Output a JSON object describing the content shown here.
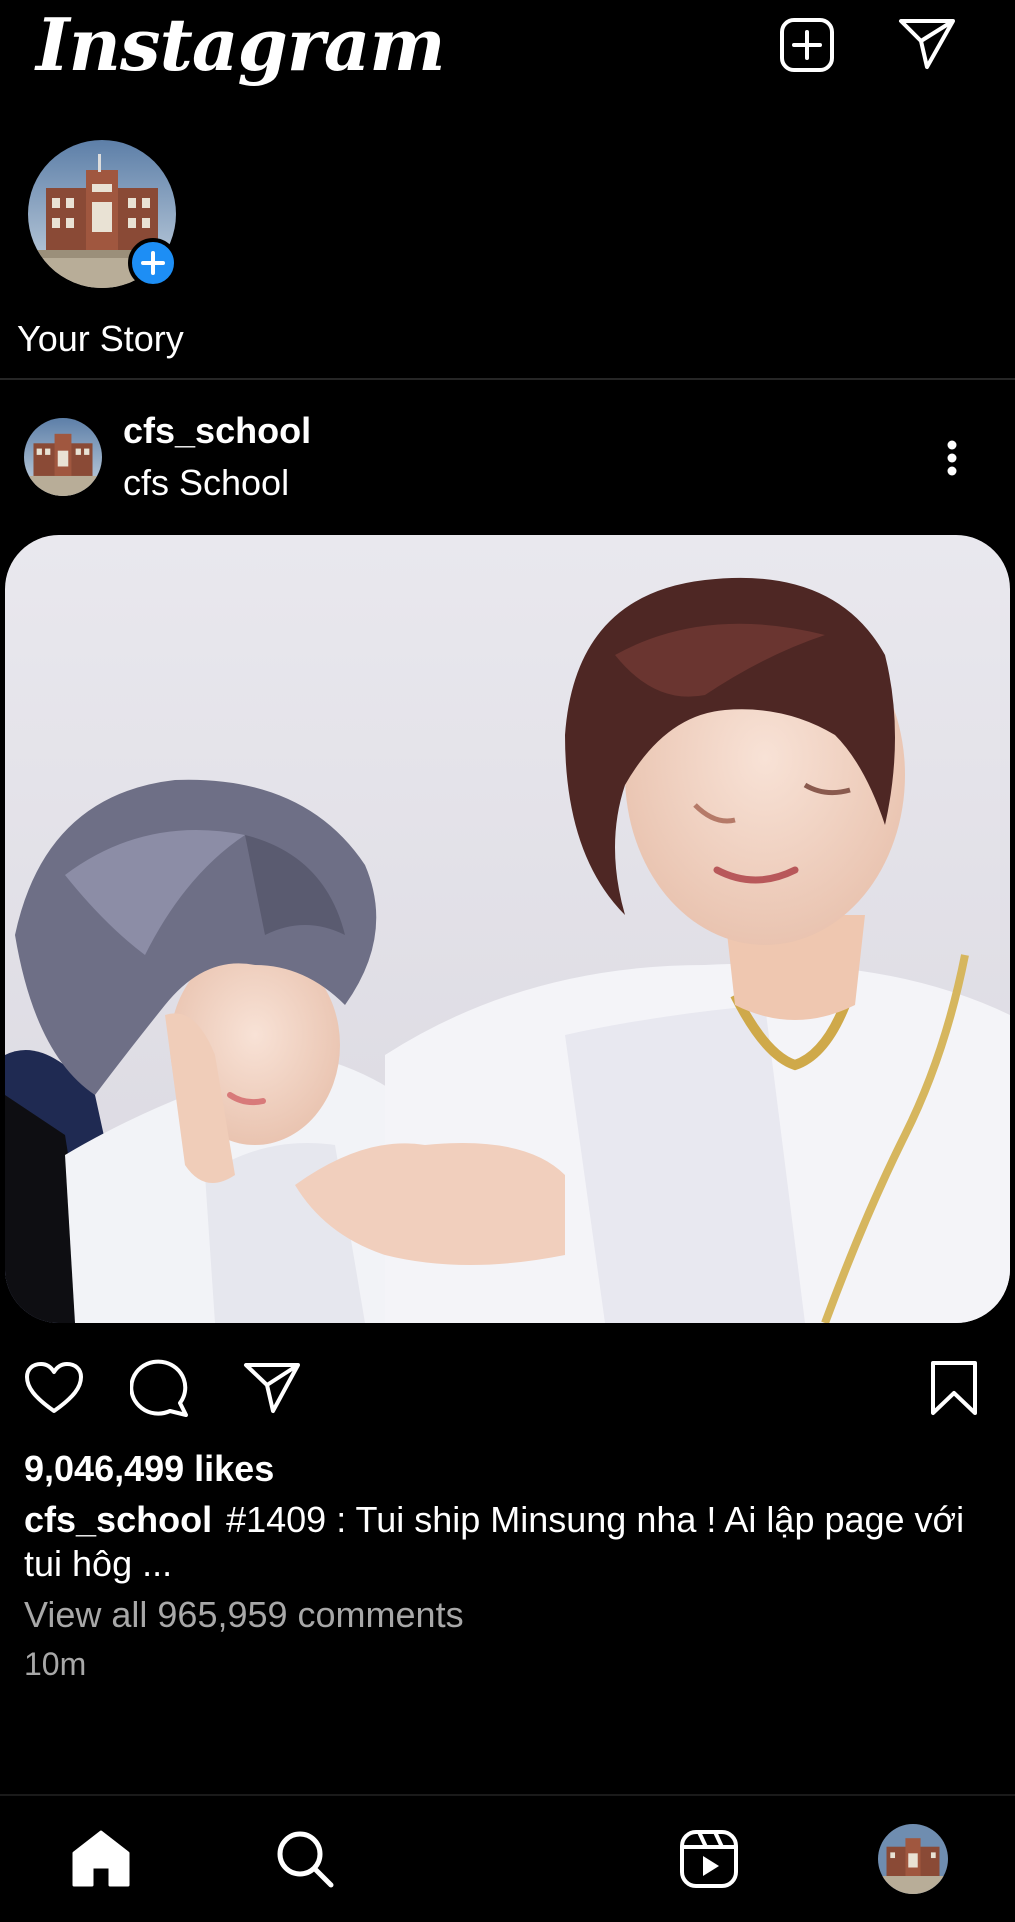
{
  "header": {
    "logo_text": "Instagram",
    "new_post_icon": "plus-square-icon",
    "direct_icon": "paper-plane-icon"
  },
  "stories": {
    "your_story_label": "Your Story",
    "add_icon": "plus-circle-icon"
  },
  "post": {
    "username": "cfs_school",
    "subtitle": "cfs School",
    "more_icon": "more-vertical-icon",
    "likes_text": "9,046,499 likes",
    "caption_user": "cfs_school",
    "caption_text": "#1409 : Tui ship Minsung nha ! Ai lập page với tui hôg ...",
    "comments_text": "View all 965,959 comments",
    "time_text": "10m",
    "actions": {
      "like_icon": "heart-icon",
      "comment_icon": "comment-icon",
      "share_icon": "paper-plane-icon",
      "save_icon": "bookmark-icon"
    }
  },
  "bottom_nav": {
    "items": [
      "home-icon",
      "search-icon",
      "reels-icon",
      "profile-avatar"
    ]
  },
  "colors": {
    "background": "#000000",
    "accent_blue": "#1d8ef5",
    "secondary_text": "#a8a8a8"
  }
}
